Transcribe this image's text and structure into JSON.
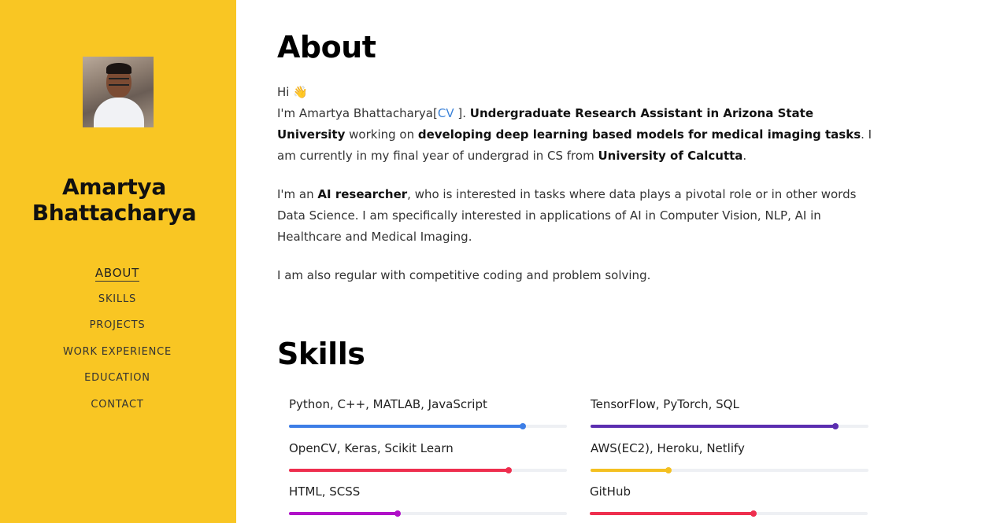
{
  "sidebar": {
    "name": "Amartya Bhattacharya",
    "nav": [
      {
        "label": "ABOUT",
        "active": true
      },
      {
        "label": "SKILLS"
      },
      {
        "label": "PROJECTS"
      },
      {
        "label": "WORK EXPERIENCE"
      },
      {
        "label": "EDUCATION"
      },
      {
        "label": "CONTACT"
      }
    ]
  },
  "about": {
    "title": "About",
    "greeting": "Hi 👋",
    "intro_prefix": "I'm Amartya Bhattacharya[",
    "cv_link": "CV",
    "intro_after_cv": " ]. ",
    "role_bold": "Undergraduate Research Assistant in Arizona State University",
    "role_after": " working on ",
    "topic_bold": "developing deep learning based models for medical imaging tasks",
    "topic_after": ". I am currently in my final year of undergrad in CS from ",
    "university_bold": "University of Calcutta",
    "university_after": ".",
    "p2_prefix": "I'm an ",
    "p2_bold": "AI researcher",
    "p2_rest": ", who is interested in tasks where data plays a pivotal role or in other words Data Science. I am specifically interested in applications of AI in Computer Vision, NLP, AI in Healthcare and Medical Imaging.",
    "p3": "I am also regular with competitive coding and problem solving."
  },
  "skills": {
    "title": "Skills",
    "items": [
      {
        "label": "Python, C++, MATLAB, JavaScript",
        "level": 0.84,
        "color": "#3d7ee6"
      },
      {
        "label": "TensorFlow, PyTorch, SQL",
        "level": 0.88,
        "color": "#5b2eb0"
      },
      {
        "label": "OpenCV, Keras, Scikit Learn",
        "level": 0.79,
        "color": "#ee2e4e"
      },
      {
        "label": "AWS(EC2), Heroku, Netlify",
        "level": 0.28,
        "color": "#f4c021"
      },
      {
        "label": "HTML, SCSS",
        "level": 0.39,
        "color": "#b010c8"
      },
      {
        "label": "GitHub",
        "level": 0.59,
        "color": "#ee2e4e"
      }
    ]
  }
}
